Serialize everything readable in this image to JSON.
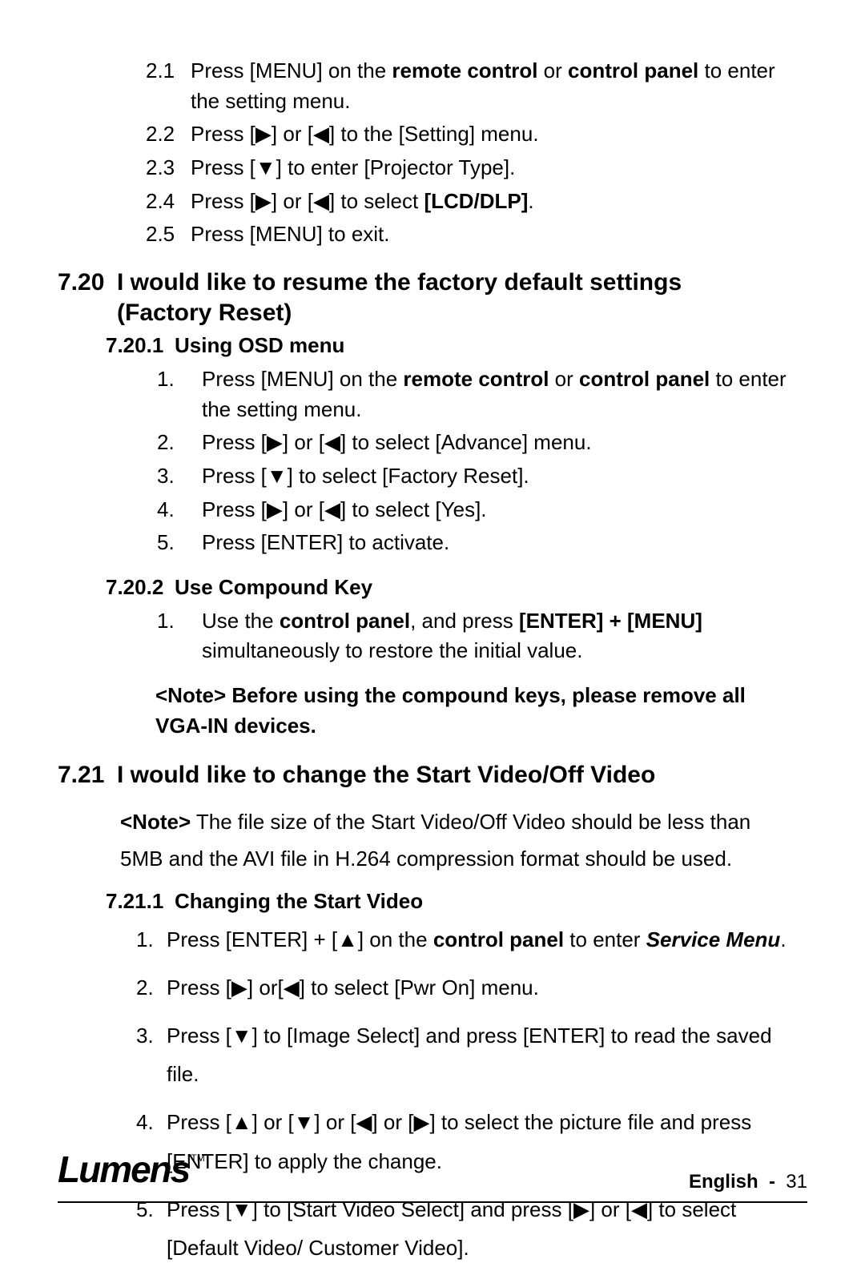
{
  "glyphs": {
    "right": "▶",
    "left": "◀",
    "up": "▲",
    "down": "▼"
  },
  "top_list": {
    "items": [
      {
        "num": "2.1",
        "parts": [
          {
            "t": "Press [MENU] on the "
          },
          {
            "t": "remote control",
            "b": true
          },
          {
            "t": " or "
          },
          {
            "t": "control panel",
            "b": true
          },
          {
            "t": " to enter the setting menu."
          }
        ]
      },
      {
        "num": "2.2",
        "parts": [
          {
            "t": "Press ["
          },
          {
            "icon": "right"
          },
          {
            "t": "] or ["
          },
          {
            "icon": "left"
          },
          {
            "t": "] to the [Setting] menu."
          }
        ]
      },
      {
        "num": "2.3",
        "parts": [
          {
            "t": "Press ["
          },
          {
            "icon": "down"
          },
          {
            "t": "] to enter [Projector Type]."
          }
        ]
      },
      {
        "num": "2.4",
        "parts": [
          {
            "t": "Press ["
          },
          {
            "icon": "right"
          },
          {
            "t": "] or ["
          },
          {
            "icon": "left"
          },
          {
            "t": "] to select "
          },
          {
            "t": "[LCD/DLP]",
            "b": true
          },
          {
            "t": "."
          }
        ]
      },
      {
        "num": "2.5",
        "parts": [
          {
            "t": "Press [MENU] to exit."
          }
        ]
      }
    ]
  },
  "section_720": {
    "num": "7.20",
    "title_line1": "I would like to resume the factory default settings",
    "title_line2": "(Factory Reset)",
    "sub1": {
      "num": "7.20.1",
      "title": "Using OSD menu",
      "items": [
        {
          "num": "1.",
          "parts": [
            {
              "t": "Press [MENU] on the "
            },
            {
              "t": "remote control",
              "b": true
            },
            {
              "t": " or "
            },
            {
              "t": "control panel",
              "b": true
            },
            {
              "t": " to enter the setting menu."
            }
          ]
        },
        {
          "num": "2.",
          "parts": [
            {
              "t": "Press ["
            },
            {
              "icon": "right"
            },
            {
              "t": "] or ["
            },
            {
              "icon": "left"
            },
            {
              "t": "] to select [Advance] menu."
            }
          ]
        },
        {
          "num": "3.",
          "parts": [
            {
              "t": "Press ["
            },
            {
              "icon": "down"
            },
            {
              "t": "] to select [Factory Reset]."
            }
          ]
        },
        {
          "num": "4.",
          "parts": [
            {
              "t": "Press ["
            },
            {
              "icon": "right"
            },
            {
              "t": "] or ["
            },
            {
              "icon": "left"
            },
            {
              "t": "] to select [Yes]."
            }
          ]
        },
        {
          "num": "5.",
          "parts": [
            {
              "t": "Press [ENTER] to activate."
            }
          ]
        }
      ]
    },
    "sub2": {
      "num": "7.20.2",
      "title": "Use Compound Key",
      "items": [
        {
          "num": "1.",
          "parts": [
            {
              "t": "Use the "
            },
            {
              "t": "control panel",
              "b": true
            },
            {
              "t": ", and press "
            },
            {
              "t": "[ENTER] + [MENU]",
              "b": true
            },
            {
              "t": " simultaneously to restore the initial value."
            }
          ]
        }
      ],
      "note": "<Note> Before using the compound keys, please remove all VGA-IN devices."
    }
  },
  "section_721": {
    "num": "7.21",
    "title": "I would like to change the Start Video/Off Video",
    "note_parts": [
      {
        "t": "<Note>",
        "b": true
      },
      {
        "t": " The file size of the Start Video/Off Video should be less than 5MB and the AVI file in H.264 compression format should be used."
      }
    ],
    "sub1": {
      "num": "7.21.1",
      "title": "Changing the Start Video",
      "items": [
        {
          "num": "1.",
          "parts": [
            {
              "t": "Press [ENTER] + ["
            },
            {
              "icon": "up"
            },
            {
              "t": "] on the "
            },
            {
              "t": "control panel",
              "b": true
            },
            {
              "t": " to enter "
            },
            {
              "t": "Service Menu",
              "bi": true
            },
            {
              "t": "."
            }
          ]
        },
        {
          "num": "2.",
          "parts": [
            {
              "t": "Press ["
            },
            {
              "icon": "right"
            },
            {
              "t": "] or["
            },
            {
              "icon": "left"
            },
            {
              "t": "] to select [Pwr On] menu."
            }
          ]
        },
        {
          "num": "3.",
          "parts": [
            {
              "t": "Press ["
            },
            {
              "icon": "down"
            },
            {
              "t": "] to [Image Select] and press [ENTER] to read the saved file."
            }
          ]
        },
        {
          "num": "4.",
          "parts": [
            {
              "t": "Press ["
            },
            {
              "icon": "up"
            },
            {
              "t": "] or ["
            },
            {
              "icon": "down"
            },
            {
              "t": "] or ["
            },
            {
              "icon": "left"
            },
            {
              "t": "] or ["
            },
            {
              "icon": "right"
            },
            {
              "t": "] to select the picture file and press [ENTER] to apply the change."
            }
          ]
        },
        {
          "num": "5.",
          "parts": [
            {
              "t": "Press ["
            },
            {
              "icon": "down"
            },
            {
              "t": "] to [Start Video Select] and press ["
            },
            {
              "icon": "right"
            },
            {
              "t": "] or ["
            },
            {
              "icon": "left"
            },
            {
              "t": "] to select [Default Video/ Customer Video]."
            }
          ]
        }
      ]
    }
  },
  "footer": {
    "brand": "Lumens",
    "tm": "TM",
    "lang_label": "English",
    "sep": "-",
    "page_number": "31"
  }
}
